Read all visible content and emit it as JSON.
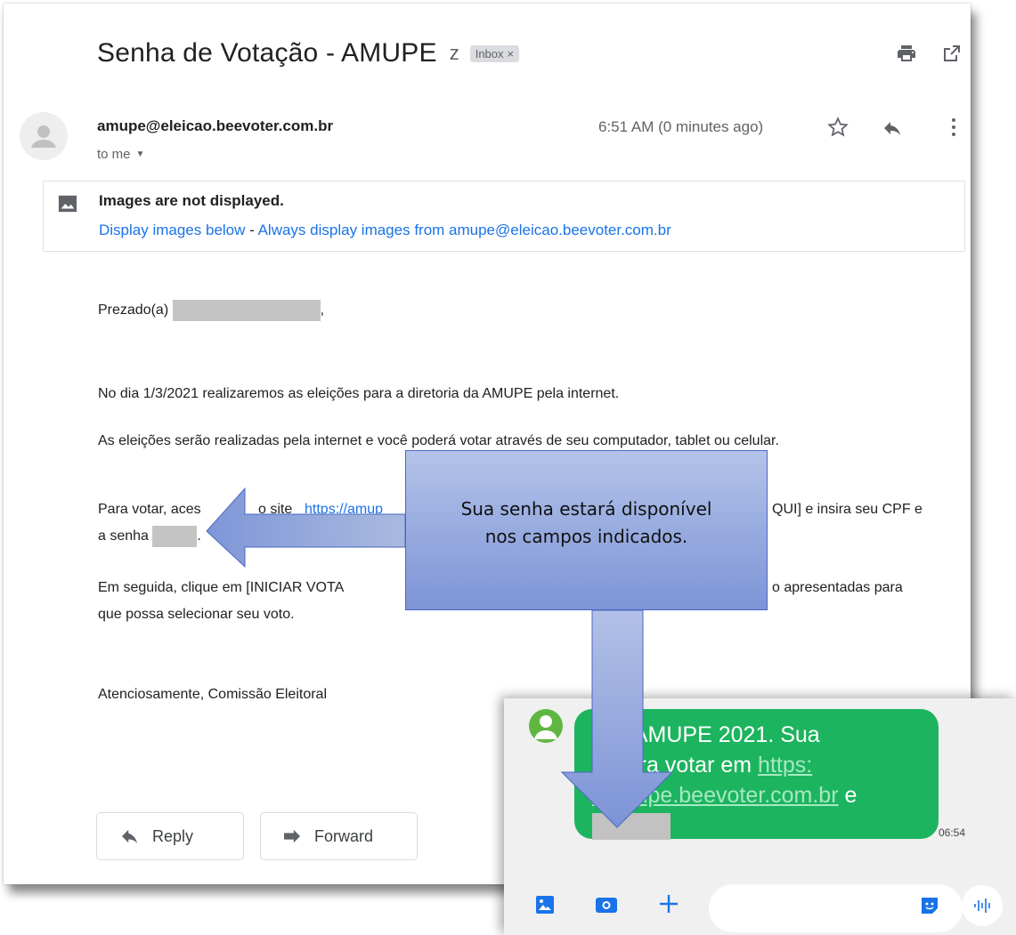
{
  "email": {
    "subject": "Senha de Votação - AMUPE",
    "label_chip": "Inbox",
    "label_chip_close": "×",
    "sender": "amupe@eleicao.beevoter.com.br",
    "recipient": "to me",
    "timestamp": "6:51 AM (0 minutes ago)",
    "image_notice": {
      "title": "Images are not displayed.",
      "display_below": "Display images below",
      "separator": " - ",
      "always_display": "Always display images from amupe@eleicao.beevoter.com.br"
    },
    "body": {
      "greeting_prefix": "Prezado(a)",
      "greeting_suffix": ",",
      "para1": "No dia 1/3/2021 realizaremos as eleições para a diretoria da AMUPE pela internet.",
      "para2": "As eleições serão realizadas pela internet e você poderá votar através de seu computador, tablet ou celular.",
      "para3_start": "Para votar, aces",
      "para3_middle": "o site",
      "para3_link": "https://amup",
      "para3_end": "QUI] e insira seu CPF e",
      "para3_line2": "a senha",
      "para3_line2_end": ".",
      "para4_start": "Em seguida, clique em [INICIAR VOTA",
      "para4_end": "o apresentadas para",
      "para4_line2": "que possa selecionar seu voto.",
      "signature": "Atenciosamente, Comissão Eleitoral"
    },
    "actions": {
      "reply": "Reply",
      "forward": "Forward"
    }
  },
  "sms": {
    "message_line1": "oes AMUPE 2021. Sua",
    "message_line2": "a para votar em",
    "link_part1": "https:",
    "link_part2": "//amupe.beevoter.com.br",
    "message_end": "e",
    "time": "06:54"
  },
  "callout": {
    "line1": "Sua senha estará disponível",
    "line2": "nos campos indicados."
  },
  "colors": {
    "link": "#1a73e8",
    "sms_bubble": "#1db45f",
    "callout_fill": "#9db0e2",
    "callout_border": "#4a67c2"
  }
}
